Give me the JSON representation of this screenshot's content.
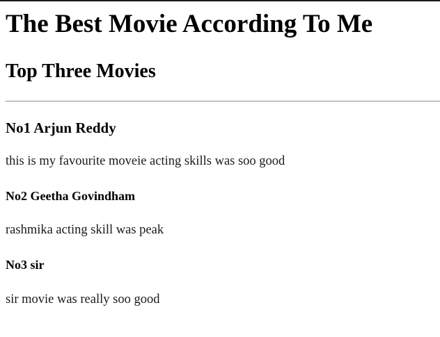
{
  "page": {
    "title": "The Best Movie According To Me",
    "subtitle": "Top Three Movies"
  },
  "movies": [
    {
      "title": "No1 Arjun Reddy",
      "description": "this is my favourite moveie acting skills was soo good"
    },
    {
      "title": "No2 Geetha Govindham",
      "description": "rashmika acting skill was peak"
    },
    {
      "title": "No3 sir",
      "description": "sir movie was really soo good"
    }
  ]
}
